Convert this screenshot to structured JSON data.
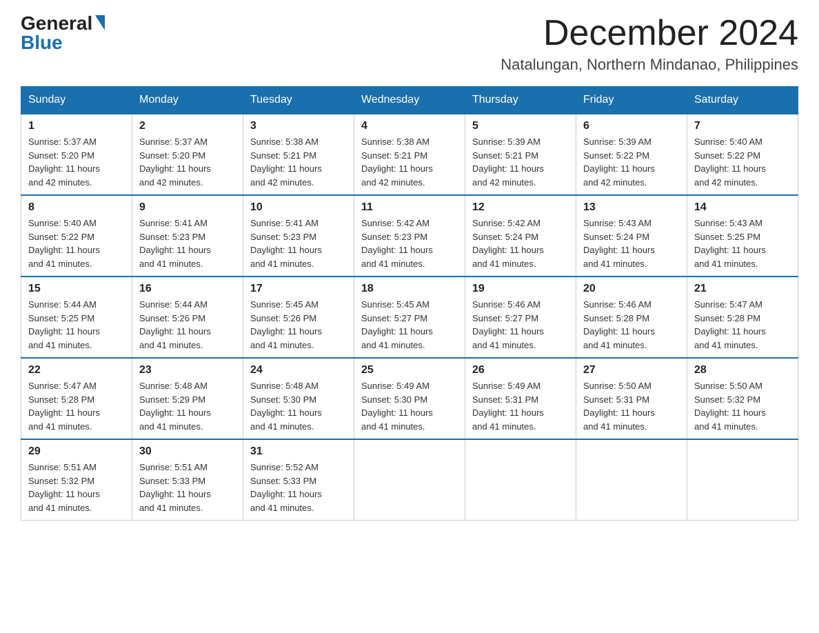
{
  "logo": {
    "general": "General",
    "blue": "Blue"
  },
  "title": "December 2024",
  "subtitle": "Natalungan, Northern Mindanao, Philippines",
  "weekdays": [
    "Sunday",
    "Monday",
    "Tuesday",
    "Wednesday",
    "Thursday",
    "Friday",
    "Saturday"
  ],
  "weeks": [
    [
      {
        "day": "1",
        "sunrise": "5:37 AM",
        "sunset": "5:20 PM",
        "daylight": "11 hours and 42 minutes."
      },
      {
        "day": "2",
        "sunrise": "5:37 AM",
        "sunset": "5:20 PM",
        "daylight": "11 hours and 42 minutes."
      },
      {
        "day": "3",
        "sunrise": "5:38 AM",
        "sunset": "5:21 PM",
        "daylight": "11 hours and 42 minutes."
      },
      {
        "day": "4",
        "sunrise": "5:38 AM",
        "sunset": "5:21 PM",
        "daylight": "11 hours and 42 minutes."
      },
      {
        "day": "5",
        "sunrise": "5:39 AM",
        "sunset": "5:21 PM",
        "daylight": "11 hours and 42 minutes."
      },
      {
        "day": "6",
        "sunrise": "5:39 AM",
        "sunset": "5:22 PM",
        "daylight": "11 hours and 42 minutes."
      },
      {
        "day": "7",
        "sunrise": "5:40 AM",
        "sunset": "5:22 PM",
        "daylight": "11 hours and 42 minutes."
      }
    ],
    [
      {
        "day": "8",
        "sunrise": "5:40 AM",
        "sunset": "5:22 PM",
        "daylight": "11 hours and 41 minutes."
      },
      {
        "day": "9",
        "sunrise": "5:41 AM",
        "sunset": "5:23 PM",
        "daylight": "11 hours and 41 minutes."
      },
      {
        "day": "10",
        "sunrise": "5:41 AM",
        "sunset": "5:23 PM",
        "daylight": "11 hours and 41 minutes."
      },
      {
        "day": "11",
        "sunrise": "5:42 AM",
        "sunset": "5:23 PM",
        "daylight": "11 hours and 41 minutes."
      },
      {
        "day": "12",
        "sunrise": "5:42 AM",
        "sunset": "5:24 PM",
        "daylight": "11 hours and 41 minutes."
      },
      {
        "day": "13",
        "sunrise": "5:43 AM",
        "sunset": "5:24 PM",
        "daylight": "11 hours and 41 minutes."
      },
      {
        "day": "14",
        "sunrise": "5:43 AM",
        "sunset": "5:25 PM",
        "daylight": "11 hours and 41 minutes."
      }
    ],
    [
      {
        "day": "15",
        "sunrise": "5:44 AM",
        "sunset": "5:25 PM",
        "daylight": "11 hours and 41 minutes."
      },
      {
        "day": "16",
        "sunrise": "5:44 AM",
        "sunset": "5:26 PM",
        "daylight": "11 hours and 41 minutes."
      },
      {
        "day": "17",
        "sunrise": "5:45 AM",
        "sunset": "5:26 PM",
        "daylight": "11 hours and 41 minutes."
      },
      {
        "day": "18",
        "sunrise": "5:45 AM",
        "sunset": "5:27 PM",
        "daylight": "11 hours and 41 minutes."
      },
      {
        "day": "19",
        "sunrise": "5:46 AM",
        "sunset": "5:27 PM",
        "daylight": "11 hours and 41 minutes."
      },
      {
        "day": "20",
        "sunrise": "5:46 AM",
        "sunset": "5:28 PM",
        "daylight": "11 hours and 41 minutes."
      },
      {
        "day": "21",
        "sunrise": "5:47 AM",
        "sunset": "5:28 PM",
        "daylight": "11 hours and 41 minutes."
      }
    ],
    [
      {
        "day": "22",
        "sunrise": "5:47 AM",
        "sunset": "5:28 PM",
        "daylight": "11 hours and 41 minutes."
      },
      {
        "day": "23",
        "sunrise": "5:48 AM",
        "sunset": "5:29 PM",
        "daylight": "11 hours and 41 minutes."
      },
      {
        "day": "24",
        "sunrise": "5:48 AM",
        "sunset": "5:30 PM",
        "daylight": "11 hours and 41 minutes."
      },
      {
        "day": "25",
        "sunrise": "5:49 AM",
        "sunset": "5:30 PM",
        "daylight": "11 hours and 41 minutes."
      },
      {
        "day": "26",
        "sunrise": "5:49 AM",
        "sunset": "5:31 PM",
        "daylight": "11 hours and 41 minutes."
      },
      {
        "day": "27",
        "sunrise": "5:50 AM",
        "sunset": "5:31 PM",
        "daylight": "11 hours and 41 minutes."
      },
      {
        "day": "28",
        "sunrise": "5:50 AM",
        "sunset": "5:32 PM",
        "daylight": "11 hours and 41 minutes."
      }
    ],
    [
      {
        "day": "29",
        "sunrise": "5:51 AM",
        "sunset": "5:32 PM",
        "daylight": "11 hours and 41 minutes."
      },
      {
        "day": "30",
        "sunrise": "5:51 AM",
        "sunset": "5:33 PM",
        "daylight": "11 hours and 41 minutes."
      },
      {
        "day": "31",
        "sunrise": "5:52 AM",
        "sunset": "5:33 PM",
        "daylight": "11 hours and 41 minutes."
      },
      null,
      null,
      null,
      null
    ]
  ],
  "labels": {
    "sunrise": "Sunrise:",
    "sunset": "Sunset:",
    "daylight": "Daylight:"
  }
}
